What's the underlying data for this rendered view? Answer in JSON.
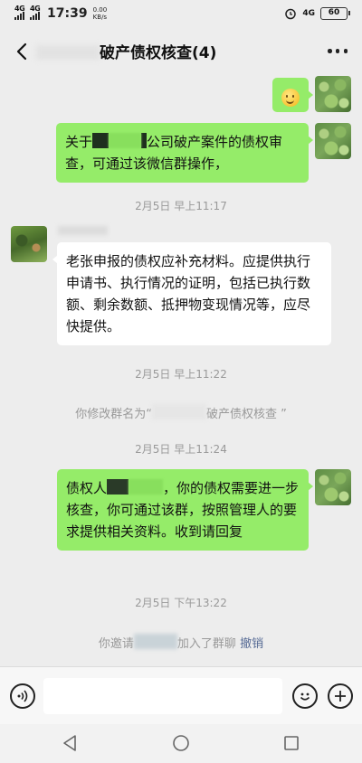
{
  "status_bar": {
    "network1": "4G",
    "network2": "4G",
    "time": "17:39",
    "speed_value": "0.00",
    "speed_unit": "KB/s",
    "net_right": "4G",
    "battery": "60"
  },
  "header": {
    "title": "破产债权核查(4)"
  },
  "messages": [
    {
      "type": "emoji",
      "side": "me",
      "emoji_name": "smile-emoji"
    },
    {
      "type": "text",
      "side": "me",
      "parts": [
        "关于",
        "公司破产案件的债权审查，可通过该微信群操作，"
      ]
    },
    {
      "type": "time",
      "text": "2月5日 早上11:17"
    },
    {
      "type": "text",
      "side": "other",
      "text": "老张申报的债权应补充材料。应提供执行申请书、执行情况的证明，包括已执行数额、剩余数额、抵押物变现情况等，应尽快提供。"
    },
    {
      "type": "time",
      "text": "2月5日 早上11:22"
    },
    {
      "type": "system",
      "parts": [
        "你修改群名为“",
        "破产债权核查 ”"
      ]
    },
    {
      "type": "time",
      "text": "2月5日 早上11:24"
    },
    {
      "type": "text",
      "side": "me",
      "parts": [
        "债权人",
        "，你的债权需要进一步核查，你可通过该群，按照管理人的要求提供相关资料。收到请回复"
      ]
    },
    {
      "type": "time",
      "text": "2月5日 下午13:22"
    },
    {
      "type": "system",
      "parts": [
        "你邀请",
        "加入了群聊",
        "撤销"
      ]
    }
  ],
  "colors": {
    "bubble_me": "#95ec69",
    "bubble_other": "#ffffff",
    "background": "#ededed",
    "link": "#576b95"
  },
  "icons": {
    "back": "back-arrow-icon",
    "more": "more-icon",
    "voice": "voice-icon",
    "emoji": "emoji-icon",
    "plus": "plus-icon"
  }
}
